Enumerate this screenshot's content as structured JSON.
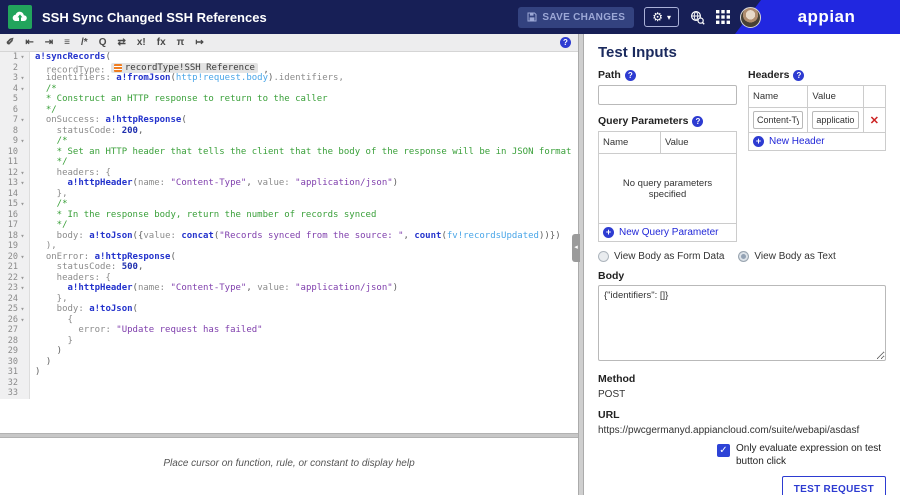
{
  "header": {
    "title": "SSH Sync Changed SSH References",
    "save_button_label": "SAVE CHANGES",
    "logo_text": "appian",
    "gear_caret": "▾"
  },
  "colors": {
    "header_bar": "#171f56",
    "logo_wedge": "#2127e0",
    "app_icon_green": "#22a45c",
    "accent_blue": "#2d3bd1",
    "delete_red": "#cc2222",
    "code_function": "#2433cc",
    "code_comment": "#3aa03a",
    "code_string": "#8040ad",
    "code_domain_var": "#4aa6e8"
  },
  "editor_toolbar": {
    "icons": [
      {
        "name": "format-wand-icon",
        "glyph": "✐"
      },
      {
        "name": "outdent-icon",
        "glyph": "⇤"
      },
      {
        "name": "indent-icon",
        "glyph": "⇥"
      },
      {
        "name": "outline-icon",
        "glyph": "≡"
      },
      {
        "name": "comment-icon",
        "glyph": "/*"
      },
      {
        "name": "search-icon",
        "glyph": "Q"
      },
      {
        "name": "swap-icon",
        "glyph": "⇄"
      },
      {
        "name": "variable-icon",
        "glyph": "x!"
      },
      {
        "name": "function-icon",
        "glyph": "fx"
      },
      {
        "name": "pi-icon",
        "glyph": "π"
      },
      {
        "name": "exit-icon",
        "glyph": "↦"
      }
    ],
    "help_glyph": "?"
  },
  "code": {
    "lines": [
      {
        "n": 1,
        "fold": true,
        "seg": [
          {
            "c": "fn",
            "t": "a!syncRecords"
          },
          {
            "c": "x",
            "t": "("
          }
        ]
      },
      {
        "n": 2,
        "fold": false,
        "seg": [
          {
            "c": "p",
            "t": "  recordType: "
          },
          {
            "c": "pill",
            "t": "recordType!SSH Reference"
          },
          {
            "c": "x",
            "t": " ,"
          }
        ]
      },
      {
        "n": 3,
        "fold": true,
        "seg": [
          {
            "c": "p",
            "t": "  identifiers: "
          },
          {
            "c": "fn",
            "t": "a!fromJson"
          },
          {
            "c": "x",
            "t": "("
          },
          {
            "c": "v",
            "t": "http!request.body"
          },
          {
            "c": "x",
            "t": ")"
          },
          {
            "c": "p",
            "t": ".identifiers,"
          }
        ]
      },
      {
        "n": 4,
        "fold": true,
        "seg": [
          {
            "c": "c",
            "t": "  /*"
          }
        ]
      },
      {
        "n": 5,
        "fold": false,
        "seg": [
          {
            "c": "c",
            "t": "  * Construct an HTTP response to return to the caller"
          }
        ]
      },
      {
        "n": 6,
        "fold": false,
        "seg": [
          {
            "c": "c",
            "t": "  */"
          }
        ]
      },
      {
        "n": 7,
        "fold": true,
        "seg": [
          {
            "c": "p",
            "t": "  onSuccess: "
          },
          {
            "c": "fn",
            "t": "a!httpResponse"
          },
          {
            "c": "x",
            "t": "("
          }
        ]
      },
      {
        "n": 8,
        "fold": false,
        "seg": [
          {
            "c": "p",
            "t": "    statusCode: "
          },
          {
            "c": "n",
            "t": "200"
          },
          {
            "c": "x",
            "t": ","
          }
        ]
      },
      {
        "n": 9,
        "fold": true,
        "seg": [
          {
            "c": "c",
            "t": "    /*"
          }
        ]
      },
      {
        "n": 10,
        "fold": false,
        "seg": [
          {
            "c": "c",
            "t": "    * Set an HTTP header that tells the client that the body of the response will be in JSON format"
          }
        ]
      },
      {
        "n": 11,
        "fold": false,
        "seg": [
          {
            "c": "c",
            "t": "    */"
          }
        ]
      },
      {
        "n": 12,
        "fold": true,
        "seg": [
          {
            "c": "p",
            "t": "    headers: {"
          }
        ]
      },
      {
        "n": 13,
        "fold": true,
        "seg": [
          {
            "c": "p",
            "t": "      "
          },
          {
            "c": "fn",
            "t": "a!httpHeader"
          },
          {
            "c": "x",
            "t": "("
          },
          {
            "c": "p",
            "t": "name: "
          },
          {
            "c": "s",
            "t": "\"Content-Type\""
          },
          {
            "c": "x",
            "t": ", "
          },
          {
            "c": "p",
            "t": "value: "
          },
          {
            "c": "s",
            "t": "\"application/json\""
          },
          {
            "c": "x",
            "t": ")"
          }
        ]
      },
      {
        "n": 14,
        "fold": false,
        "seg": [
          {
            "c": "p",
            "t": "    },"
          }
        ]
      },
      {
        "n": 15,
        "fold": true,
        "seg": [
          {
            "c": "c",
            "t": "    /*"
          }
        ]
      },
      {
        "n": 16,
        "fold": false,
        "seg": [
          {
            "c": "c",
            "t": "    * In the response body, return the number of records synced"
          }
        ]
      },
      {
        "n": 17,
        "fold": false,
        "seg": [
          {
            "c": "c",
            "t": "    */"
          }
        ]
      },
      {
        "n": 18,
        "fold": true,
        "seg": [
          {
            "c": "p",
            "t": "    body: "
          },
          {
            "c": "fn",
            "t": "a!toJson"
          },
          {
            "c": "x",
            "t": "({"
          },
          {
            "c": "p",
            "t": "value: "
          },
          {
            "c": "fn",
            "t": "concat"
          },
          {
            "c": "x",
            "t": "("
          },
          {
            "c": "s",
            "t": "\"Records synced from the source: \""
          },
          {
            "c": "x",
            "t": ", "
          },
          {
            "c": "fn",
            "t": "count"
          },
          {
            "c": "x",
            "t": "("
          },
          {
            "c": "v",
            "t": "fv!recordsUpdated"
          },
          {
            "c": "x",
            "t": "))})"
          }
        ]
      },
      {
        "n": 19,
        "fold": false,
        "seg": [
          {
            "c": "p",
            "t": "  ),"
          }
        ]
      },
      {
        "n": 20,
        "fold": true,
        "seg": [
          {
            "c": "p",
            "t": "  onError: "
          },
          {
            "c": "fn",
            "t": "a!httpResponse"
          },
          {
            "c": "x",
            "t": "("
          }
        ]
      },
      {
        "n": 21,
        "fold": false,
        "seg": [
          {
            "c": "p",
            "t": "    statusCode: "
          },
          {
            "c": "n",
            "t": "500"
          },
          {
            "c": "x",
            "t": ","
          }
        ]
      },
      {
        "n": 22,
        "fold": true,
        "seg": [
          {
            "c": "p",
            "t": "    headers: {"
          }
        ]
      },
      {
        "n": 23,
        "fold": true,
        "seg": [
          {
            "c": "p",
            "t": "      "
          },
          {
            "c": "fn",
            "t": "a!httpHeader"
          },
          {
            "c": "x",
            "t": "("
          },
          {
            "c": "p",
            "t": "name: "
          },
          {
            "c": "s",
            "t": "\"Content-Type\""
          },
          {
            "c": "x",
            "t": ", "
          },
          {
            "c": "p",
            "t": "value: "
          },
          {
            "c": "s",
            "t": "\"application/json\""
          },
          {
            "c": "x",
            "t": ")"
          }
        ]
      },
      {
        "n": 24,
        "fold": false,
        "seg": [
          {
            "c": "p",
            "t": "    },"
          }
        ]
      },
      {
        "n": 25,
        "fold": true,
        "seg": [
          {
            "c": "p",
            "t": "    body: "
          },
          {
            "c": "fn",
            "t": "a!toJson"
          },
          {
            "c": "x",
            "t": "("
          }
        ]
      },
      {
        "n": 26,
        "fold": true,
        "seg": [
          {
            "c": "p",
            "t": "      {"
          }
        ]
      },
      {
        "n": 27,
        "fold": false,
        "seg": [
          {
            "c": "p",
            "t": "        error: "
          },
          {
            "c": "s",
            "t": "\"Update request has failed\""
          }
        ]
      },
      {
        "n": 28,
        "fold": false,
        "seg": [
          {
            "c": "p",
            "t": "      }"
          }
        ]
      },
      {
        "n": 29,
        "fold": false,
        "seg": [
          {
            "c": "x",
            "t": "    )"
          }
        ]
      },
      {
        "n": 30,
        "fold": false,
        "seg": [
          {
            "c": "x",
            "t": "  )"
          }
        ]
      },
      {
        "n": 31,
        "fold": false,
        "seg": [
          {
            "c": "x",
            "t": ")"
          }
        ]
      },
      {
        "n": 32,
        "fold": false,
        "seg": []
      },
      {
        "n": 33,
        "fold": false,
        "seg": []
      }
    ],
    "fold_glyph": "▾"
  },
  "help_strip": {
    "text": "Place cursor on function, rule, or constant to display help"
  },
  "test_inputs": {
    "title": "Test Inputs",
    "path": {
      "label": "Path",
      "value": ""
    },
    "headers": {
      "label": "Headers",
      "columns": [
        "Name",
        "Value"
      ],
      "rows": [
        {
          "name": "Content-Type",
          "value": "application/json"
        }
      ],
      "delete_glyph": "✕",
      "add_link": "New Header"
    },
    "query_parameters": {
      "label": "Query Parameters",
      "columns": [
        "Name",
        "Value"
      ],
      "empty_text": "No query parameters specified",
      "add_link": "New Query Parameter"
    },
    "body_view_radios": [
      {
        "label": "View Body as Form Data",
        "selected": false
      },
      {
        "label": "View Body as Text",
        "selected": true
      }
    ],
    "body": {
      "label": "Body",
      "value": "{\"identifiers\": []}"
    },
    "method": {
      "label": "Method",
      "value": "POST"
    },
    "url": {
      "label": "URL",
      "value": "https://pwcgermanyd.appiancloud.com/suite/webapi/asdasf"
    },
    "evaluate_checkbox": {
      "label": "Only evaluate expression on test button click",
      "checked": true,
      "check_glyph": "✓"
    },
    "test_button_label": "TEST REQUEST"
  }
}
